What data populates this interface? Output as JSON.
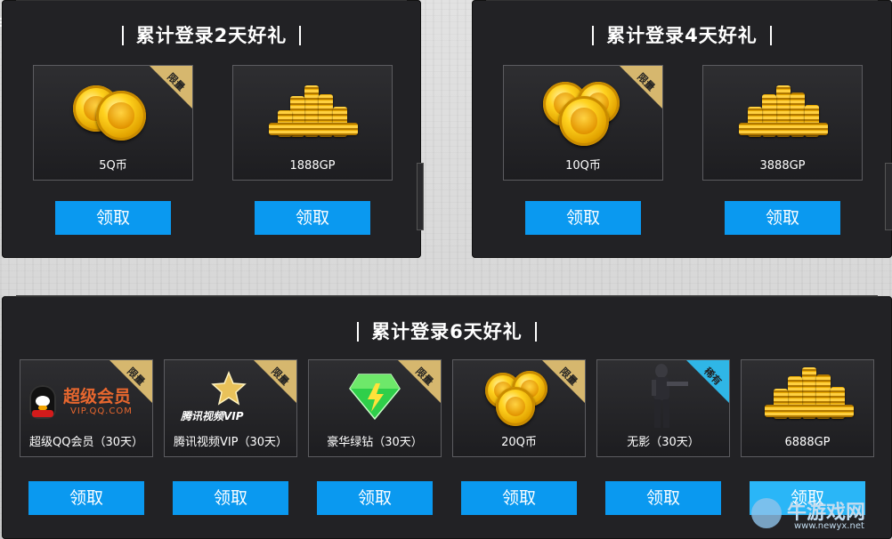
{
  "panels": {
    "day2": {
      "title": "累计登录2天好礼",
      "cards": [
        {
          "label": "5Q币",
          "ribbon": "限量",
          "icon": "q-coins-icon"
        },
        {
          "label": "1888GP",
          "ribbon": "",
          "icon": "gold-coin-pile-icon"
        }
      ],
      "button": "领取"
    },
    "day4": {
      "title": "累计登录4天好礼",
      "cards": [
        {
          "label": "10Q币",
          "ribbon": "限量",
          "icon": "q-coins-icon"
        },
        {
          "label": "3888GP",
          "ribbon": "",
          "icon": "gold-coin-pile-icon"
        }
      ],
      "button": "领取"
    },
    "day6": {
      "title": "累计登录6天好礼",
      "cards": [
        {
          "label": "超级QQ会员（30天）",
          "ribbon": "限量",
          "icon": "super-qq-member-icon",
          "logo_text": "超级会员",
          "logo_sub": "VIP.QQ.COM"
        },
        {
          "label": "腾讯视频VIP（30天）",
          "ribbon": "限量",
          "icon": "tencent-video-vip-icon",
          "logo_text": "腾讯视频VIP"
        },
        {
          "label": "豪华绿钻（30天）",
          "ribbon": "限量",
          "icon": "green-diamond-icon"
        },
        {
          "label": "20Q币",
          "ribbon": "限量",
          "icon": "q-coins-icon"
        },
        {
          "label": "无影（30天）",
          "ribbon": "稀有",
          "icon": "soldier-character-icon"
        },
        {
          "label": "6888GP",
          "ribbon": "",
          "icon": "gold-coin-pile-icon"
        }
      ],
      "button": "领取"
    }
  },
  "watermark": {
    "brand": "牛游戏网",
    "url": "www.newyx.net"
  },
  "colors": {
    "button": "#0a99f0",
    "ribbon_gold": "#d6b76e",
    "ribbon_blue": "#2fb6e6",
    "panel": "#222225"
  }
}
